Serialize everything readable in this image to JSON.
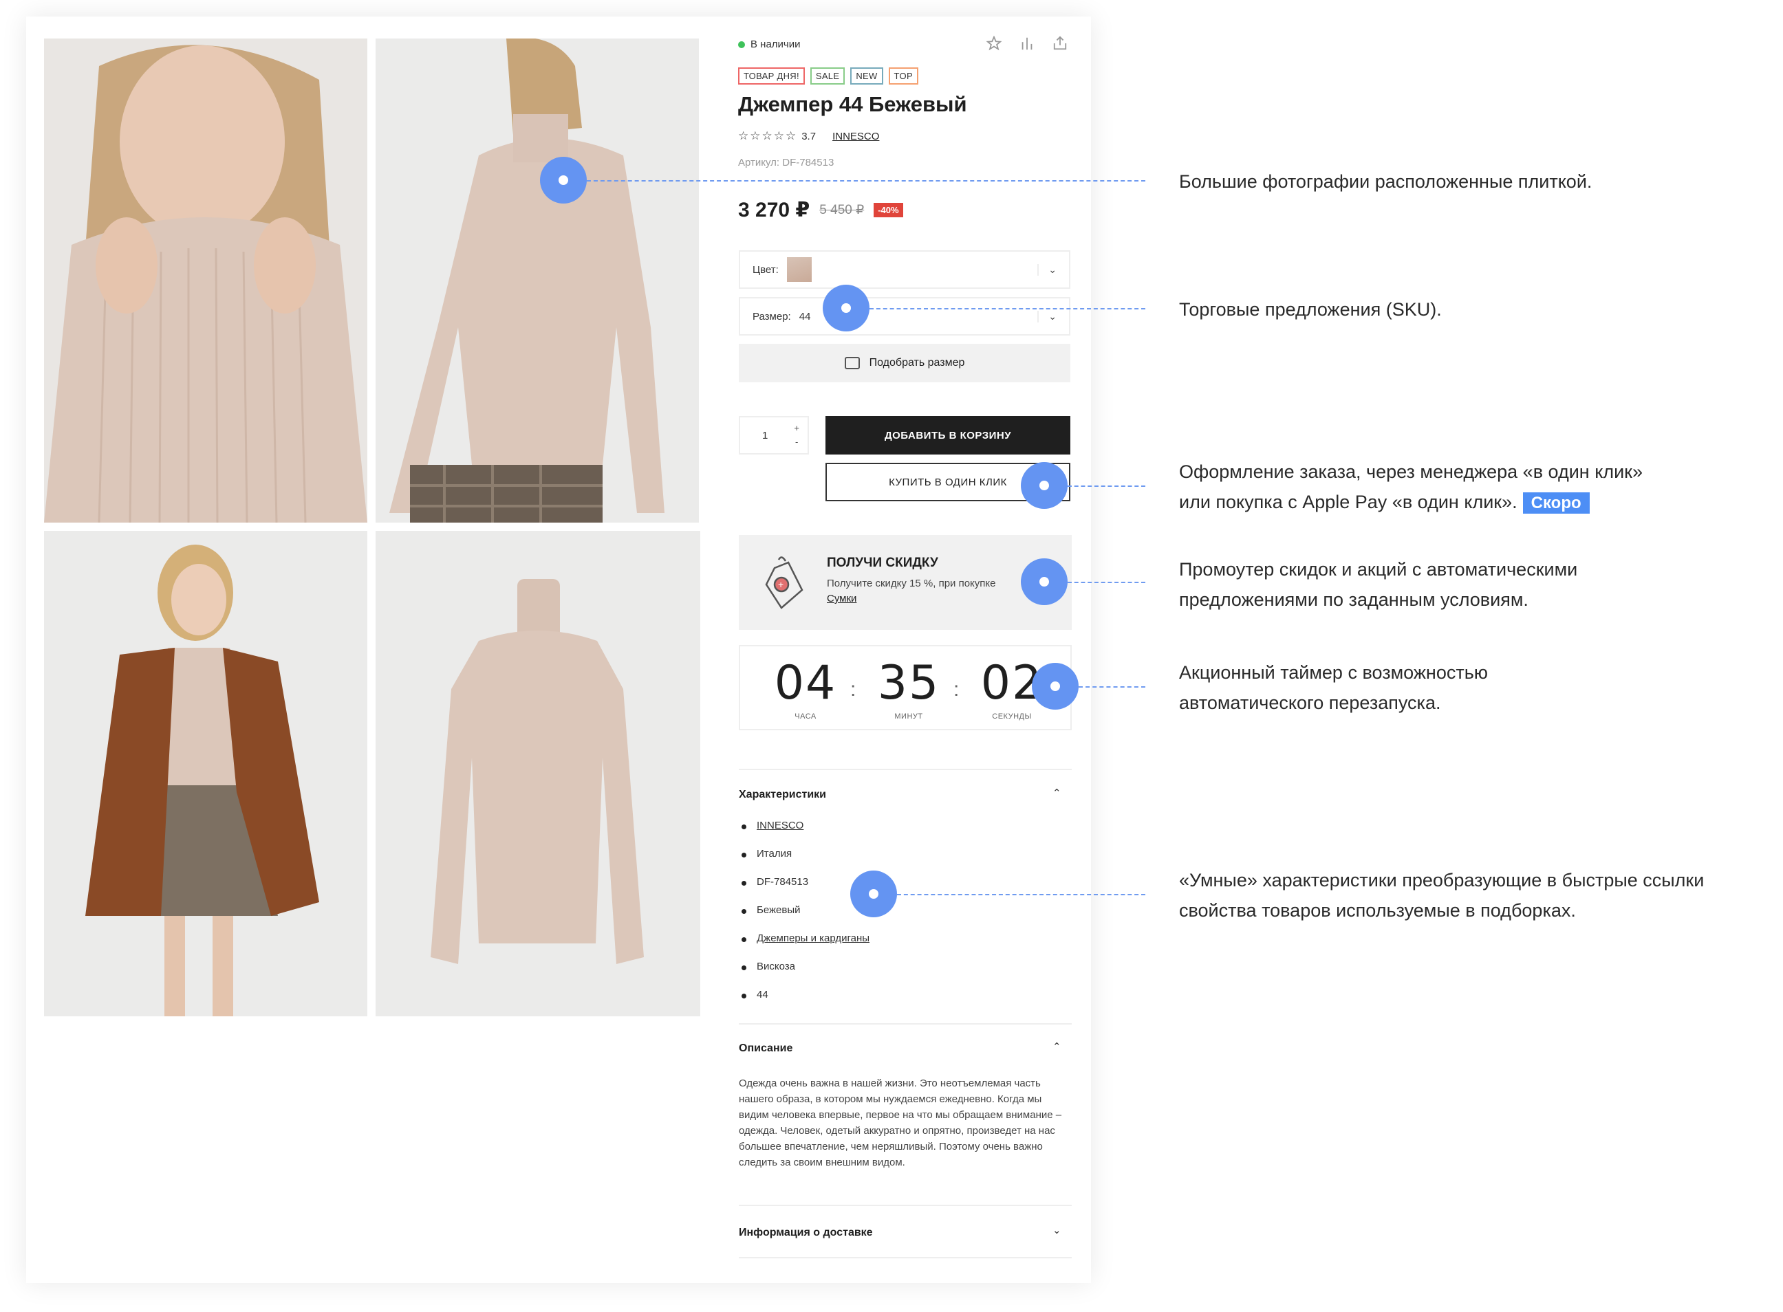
{
  "product": {
    "stock": "В наличии",
    "badges": [
      "ТОВАР ДНЯ!",
      "SALE",
      "NEW",
      "TOP"
    ],
    "title": "Джемпер 44 Бежевый",
    "rating_stars": "☆☆☆☆☆",
    "rating_value": "3.7",
    "brand": "INNESCO",
    "sku": "Артикул: DF-784513",
    "price": "3 270 ₽",
    "old_price": "5 450 ₽",
    "discount": "-40%",
    "color_label": "Цвет:",
    "size_label": "Размер:",
    "size_value": "44",
    "size_picker": "Подобрать размер",
    "quantity": "1",
    "add_to_cart": "ДОБАВИТЬ В КОРЗИНУ",
    "one_click": "КУПИТЬ В ОДИН КЛИК"
  },
  "promo": {
    "title": "ПОЛУЧИ СКИДКУ",
    "text": "Получите скидку 15 %, при покупке",
    "link": "Сумки"
  },
  "timer": {
    "hours": "04",
    "minutes": "35",
    "seconds": "02",
    "hours_label": "ЧАСА",
    "minutes_label": "МИНУТ",
    "seconds_label": "СЕКУНДЫ"
  },
  "specs": {
    "title": "Характеристики",
    "items": [
      "INNESCO",
      "Италия",
      "DF-784513",
      "Бежевый",
      "Джемперы и кардиганы",
      "Вискоза",
      "44"
    ]
  },
  "description": {
    "title": "Описание",
    "text": "Одежда очень важна в нашей жизни. Это неотъемлемая часть нашего образа, в котором мы нуждаемся ежедневно. Когда мы видим человека впервые, первое на что мы обращаем внимание – одежда. Человек, одетый аккуратно и опрятно, произведет на нас большее впечатление, чем неряшливый. Поэтому очень важно следить за своим внешним видом."
  },
  "delivery": {
    "title": "Информация о доставке"
  },
  "annotations": {
    "photos": "Большие фотографии расположенные плиткой.",
    "sku_offers": "Торговые предложения (SKU).",
    "order_line1": "Оформление заказа, через менеджера «в один клик»",
    "order_line2": "или покупка с Apple Pay «в один клик».",
    "soon": "Скоро",
    "promo_line1": "Промоутер скидок и акций с автоматическими",
    "promo_line2": "предложениями по заданным условиям.",
    "timer_line1": "Акционный таймер с возможностью",
    "timer_line2": "автоматического перезапуска.",
    "smart_line1": "«Умные» характеристики преобразующие в быстрые ссылки",
    "smart_line2": "свойства товаров используемые в подборках."
  },
  "colors": {
    "accent": "#6494f2",
    "dark": "#1f1f1f",
    "sale": "#e0443a",
    "in_stock": "#3ec25a",
    "sweater": "#dcc7ba",
    "coat": "#8a4a26"
  },
  "icons": [
    "star-icon",
    "compare-icon",
    "share-icon",
    "ruler-icon",
    "discount-tag-icon",
    "chevron-down-icon",
    "chevron-up-icon"
  ]
}
